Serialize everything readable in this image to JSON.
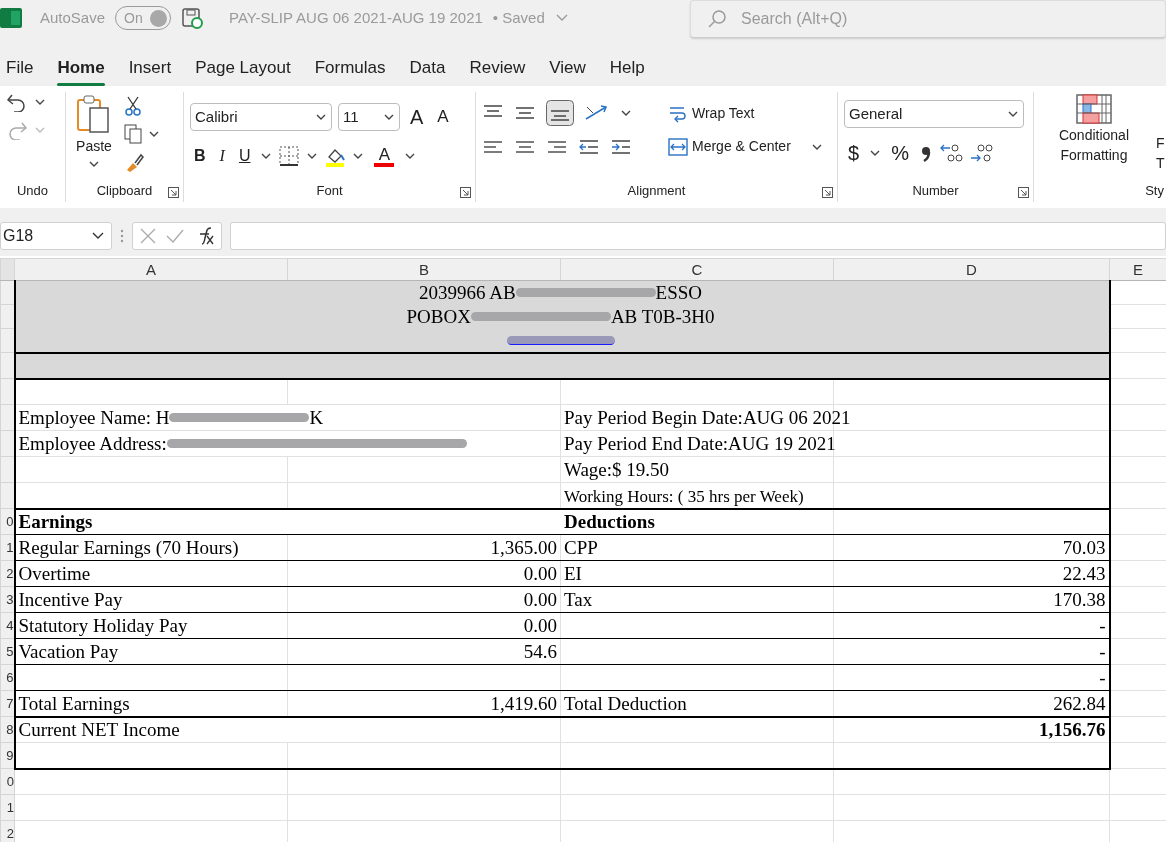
{
  "title_bar": {
    "autosave_label": "AutoSave",
    "autosave_toggle": {
      "label": "On",
      "on": true
    },
    "document_title": "PAY-SLIP AUG 06 2021-AUG 19 2021",
    "save_status": "• Saved",
    "search": {
      "placeholder": "Search (Alt+Q)"
    }
  },
  "menu_tabs": [
    {
      "label": "File",
      "selected": false
    },
    {
      "label": "Home",
      "selected": true
    },
    {
      "label": "Insert",
      "selected": false
    },
    {
      "label": "Page Layout",
      "selected": false
    },
    {
      "label": "Formulas",
      "selected": false
    },
    {
      "label": "Data",
      "selected": false
    },
    {
      "label": "Review",
      "selected": false
    },
    {
      "label": "View",
      "selected": false
    },
    {
      "label": "Help",
      "selected": false
    }
  ],
  "ribbon": {
    "undo_group": {
      "label": "Undo"
    },
    "clipboard_group": {
      "label": "Clipboard",
      "paste_label": "Paste"
    },
    "font_group": {
      "label": "Font",
      "font_name": "Calibri",
      "font_size": "11",
      "grow_font": "A",
      "shrink_font": "A",
      "bold": "B",
      "italic": "I",
      "underline": "U",
      "font_color": "A"
    },
    "alignment_group": {
      "label": "Alignment",
      "wrap_text": "Wrap Text",
      "merge_center": "Merge & Center"
    },
    "number_group": {
      "label": "Number",
      "format": "General",
      "currency": "$",
      "percent": "%"
    },
    "styles_group": {
      "label": "Sty",
      "conditional_formatting": "Conditional Formatting",
      "format_as_table": [
        "F",
        "T"
      ]
    }
  },
  "formula_bar": {
    "name_box": "G18"
  },
  "columns": [
    "A",
    "B",
    "C",
    "D",
    "E"
  ],
  "rows": [
    {
      "kind": "banner",
      "before": "2039966 AB",
      "after": "ESSO"
    },
    {
      "kind": "banner",
      "before": "POBOX",
      "after": "AB T0B-3H0"
    },
    {
      "kind": "banner-link"
    },
    {
      "kind": "divider-blank"
    },
    {
      "kind": "blank"
    },
    {
      "kind": "info",
      "left": {
        "before": "Employee Name: H",
        "after": "K"
      },
      "right": "Pay Period Begin Date:AUG 06 2021"
    },
    {
      "kind": "info",
      "left": {
        "before": "Employee Address:"
      },
      "right": "Pay Period End Date:AUG 19 2021"
    },
    {
      "kind": "info",
      "right": "Wage:$ 19.50"
    },
    {
      "kind": "info-small",
      "right": "Working Hours: ( 35 hrs per Week)"
    },
    {
      "kind": "section",
      "num": "0",
      "earning": "Earnings",
      "deduction": "Deductions"
    },
    {
      "kind": "item",
      "num": "1",
      "earning": "Regular Earnings (70 Hours)",
      "earning_amount": "1,365.00",
      "deduction": "CPP",
      "deduction_amount": "70.03"
    },
    {
      "kind": "item",
      "num": "2",
      "earning": "Overtime",
      "earning_amount": "0.00",
      "deduction": "EI",
      "deduction_amount": "22.43"
    },
    {
      "kind": "item",
      "num": "3",
      "earning": "Incentive Pay",
      "earning_amount": "0.00",
      "deduction": "Tax",
      "deduction_amount": "170.38"
    },
    {
      "kind": "item",
      "num": "4",
      "earning": "Statutory Holiday Pay",
      "earning_amount": "0.00",
      "deduction_amount": "-"
    },
    {
      "kind": "item",
      "num": "5",
      "earning": "Vacation Pay",
      "earning_amount": "54.6",
      "deduction_amount": "-"
    },
    {
      "kind": "item",
      "num": "6",
      "deduction_amount": "-"
    },
    {
      "kind": "total",
      "num": "7",
      "earning": "Total Earnings",
      "earning_amount": "1,419.60",
      "deduction": "Total Deduction",
      "deduction_amount": "262.84"
    },
    {
      "kind": "net",
      "num": "8",
      "earning": "Current NET Income",
      "deduction_amount": "1,156.76"
    },
    {
      "kind": "end-blank",
      "num": "9"
    },
    {
      "kind": "outside",
      "num": "0"
    },
    {
      "kind": "outside",
      "num": "1"
    },
    {
      "kind": "outside",
      "num": "2"
    }
  ]
}
